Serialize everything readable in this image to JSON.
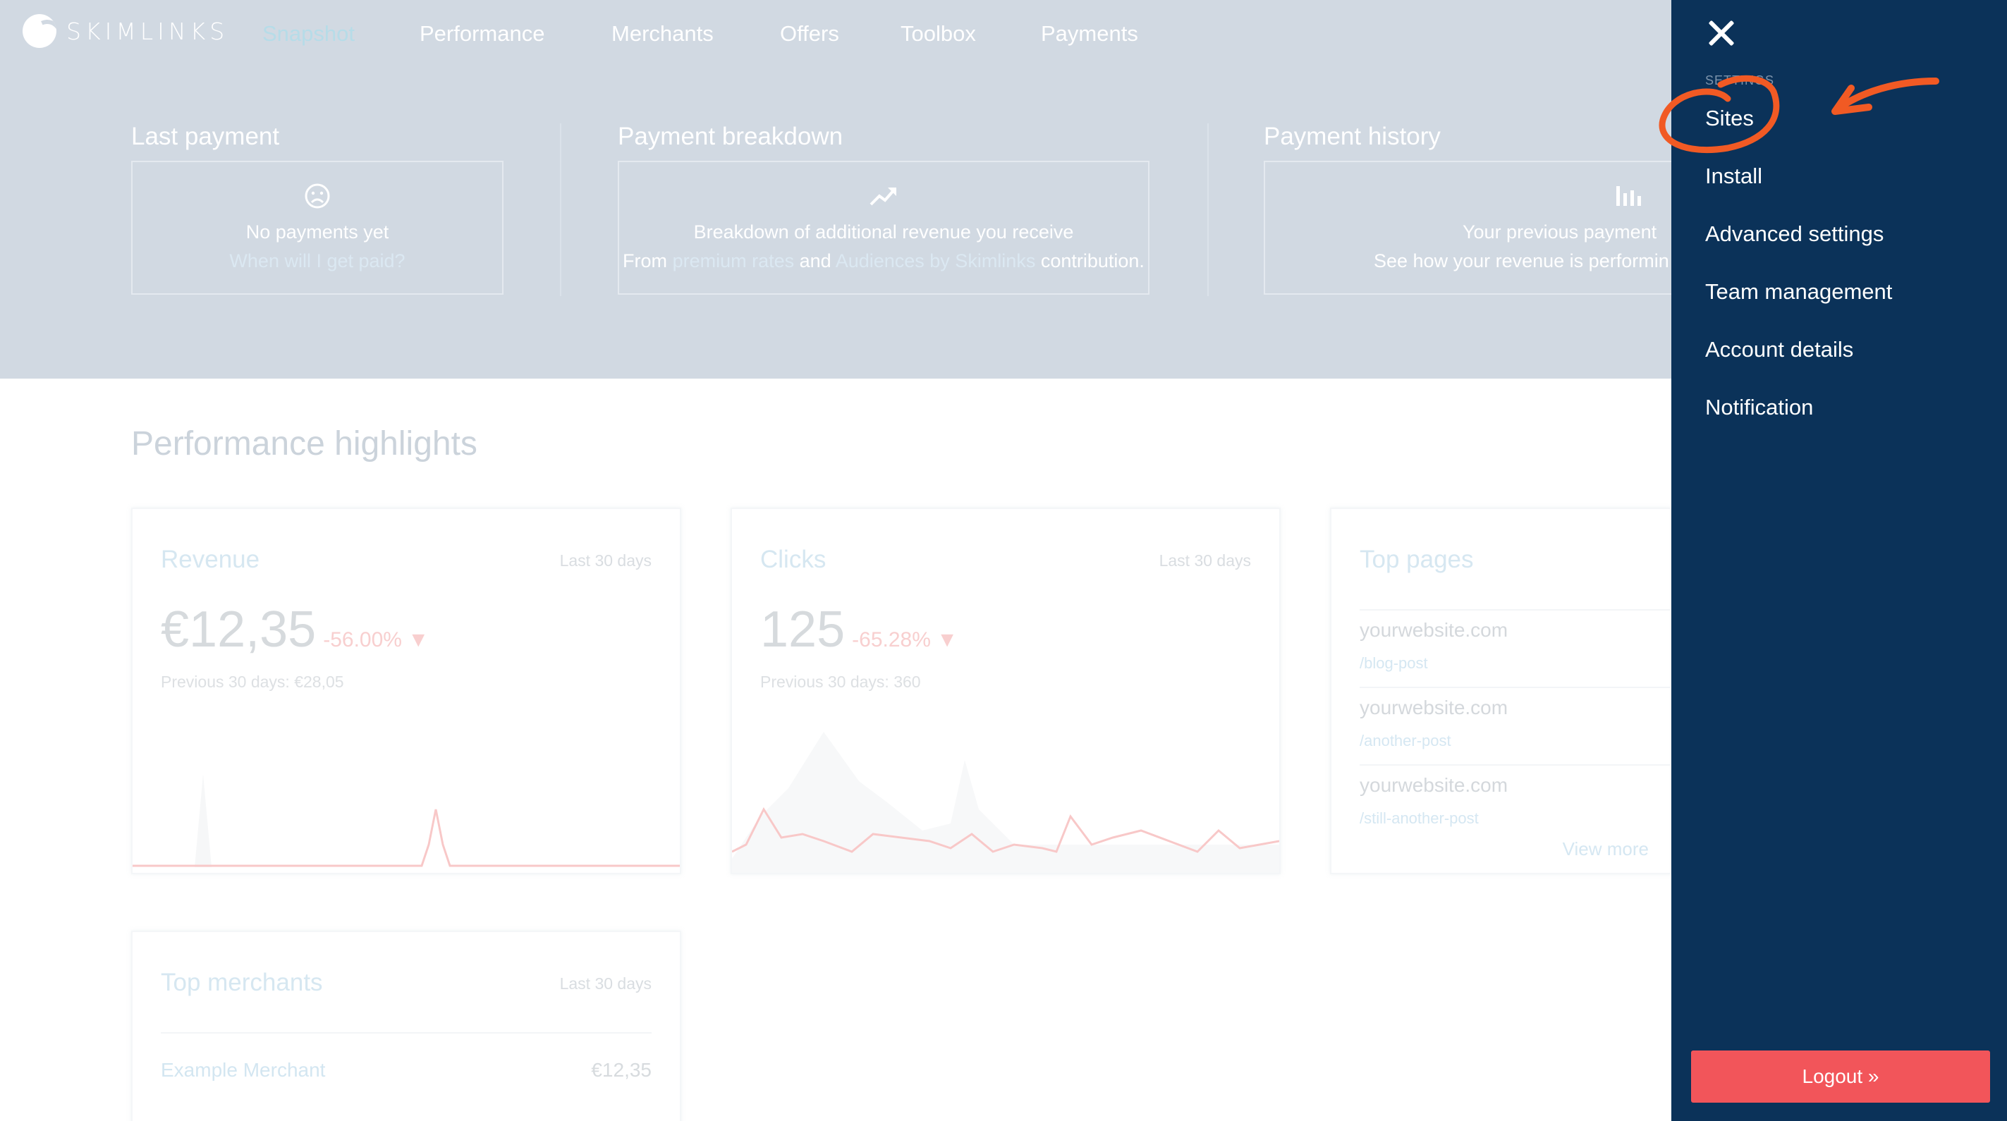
{
  "brand": {
    "logo_text": "SKIMLINKS"
  },
  "nav": {
    "items": [
      {
        "label": "Snapshot",
        "active": true
      },
      {
        "label": "Performance",
        "active": false
      },
      {
        "label": "Merchants",
        "active": false
      },
      {
        "label": "Offers",
        "active": false
      },
      {
        "label": "Toolbox",
        "active": false
      },
      {
        "label": "Payments",
        "active": false
      }
    ]
  },
  "hero": {
    "last_payment": {
      "title": "Last payment",
      "icon": "sad-face-icon",
      "heading": "No payments yet",
      "link": "When will I get paid?"
    },
    "payment_breakdown": {
      "title": "Payment breakdown",
      "icon": "trend-up-icon",
      "heading": "Breakdown of additional revenue you receive",
      "sub_prefix": "From",
      "link1": "premium rates",
      "sub_and": "and",
      "link2": "Audiences by Skimlinks",
      "sub_suffix": "contribution."
    },
    "payment_history": {
      "title": "Payment history",
      "icon": "bar-chart-icon",
      "heading": "Your previous payment",
      "sub": "See how your revenue is performin"
    }
  },
  "highlights": {
    "title": "Performance highlights",
    "revenue": {
      "title": "Revenue",
      "range": "Last 30 days",
      "value": "€12,35",
      "delta": "-56.00%",
      "previous": "Previous 30 days: €28,05"
    },
    "clicks": {
      "title": "Clicks",
      "range": "Last 30 days",
      "value": "125",
      "delta": "-65.28%",
      "previous": "Previous 30 days: 360"
    },
    "top_pages": {
      "title": "Top pages",
      "rows": [
        {
          "domain": "yourwebsite.com",
          "path": "/blog-post"
        },
        {
          "domain": "yourwebsite.com",
          "path": "/another-post"
        },
        {
          "domain": "yourwebsite.com",
          "path": "/still-another-post"
        }
      ],
      "view_more": "View more"
    },
    "top_merchants": {
      "title": "Top merchants",
      "range": "Last 30 days",
      "rows": [
        {
          "name": "Example Merchant",
          "value": "€12,35"
        }
      ]
    }
  },
  "sidebar": {
    "heading": "SETTINGS",
    "items": [
      {
        "label": "Sites"
      },
      {
        "label": "Install"
      },
      {
        "label": "Advanced settings"
      },
      {
        "label": "Team management"
      },
      {
        "label": "Account details"
      },
      {
        "label": "Notification"
      }
    ],
    "logout_label": "Logout »"
  },
  "colors": {
    "sidebar_bg": "#0b3259",
    "logout_bg": "#f2555a",
    "annotation": "#f15a24",
    "hero_overlay": "#d1d9e2",
    "delta_negative": "#f8cfcf"
  }
}
